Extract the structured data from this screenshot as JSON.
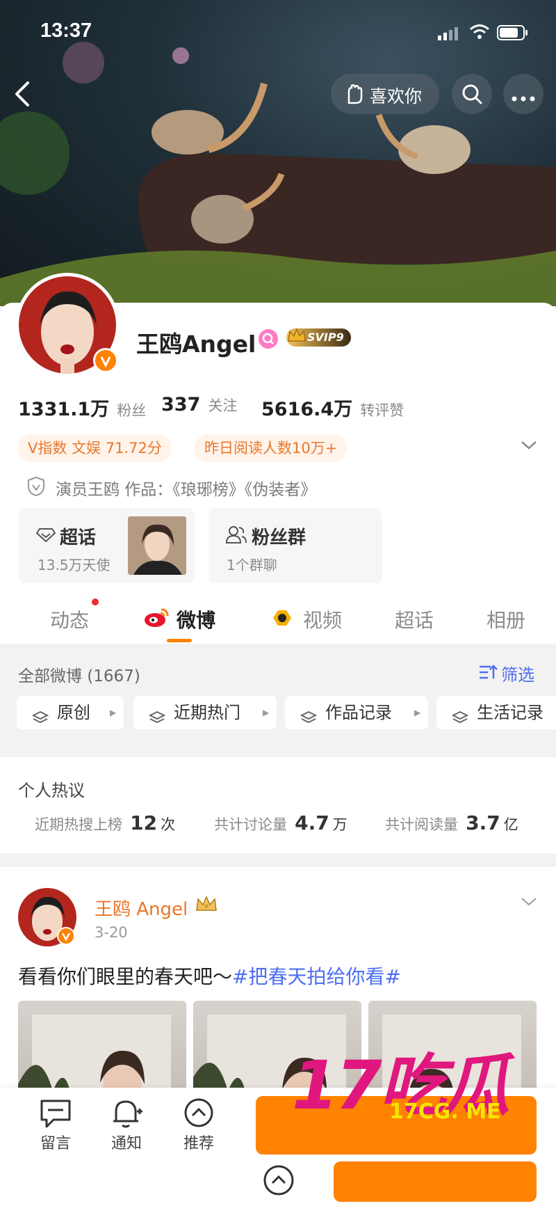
{
  "status": {
    "time": "13:37"
  },
  "header": {
    "like_label": "喜欢你"
  },
  "profile": {
    "name": "王鸥Angel",
    "svip": "SVIP9",
    "stats": [
      {
        "value": "1331.1万",
        "label": "粉丝"
      },
      {
        "value": "337",
        "label": "关注"
      },
      {
        "value": "5616.4万",
        "label": "转评赞"
      }
    ],
    "tags": [
      "V指数 文娱 71.72分",
      "昨日阅读人数10万+"
    ],
    "verify_text": "演员王鸥 作品：《琅琊榜》《伪装者》",
    "cards": [
      {
        "title": "超话",
        "sub": "13.5万天使"
      },
      {
        "title": "粉丝群",
        "sub": "1个群聊"
      }
    ],
    "tabs": [
      "动态",
      "微博",
      "视频",
      "超话",
      "相册"
    ]
  },
  "filter": {
    "all_label": "全部微博 (1667)",
    "filter_label": "筛选",
    "chips": [
      "原创",
      "近期热门",
      "作品记录",
      "生活记录"
    ]
  },
  "hot": {
    "title": "个人热议",
    "items": [
      {
        "label": "近期热搜上榜",
        "value": "12",
        "unit": "次"
      },
      {
        "label": "共计讨论量",
        "value": "4.7",
        "unit": "万"
      },
      {
        "label": "共计阅读量",
        "value": "3.7",
        "unit": "亿"
      }
    ]
  },
  "post": {
    "author": "王鸥 Angel",
    "date": "3-20",
    "text_plain": "看看你们眼里的春天吧～",
    "text_tag": "#把春天拍给你看#"
  },
  "bottom_bar": {
    "items": [
      "留言",
      "通知",
      "推荐"
    ]
  },
  "watermark": {
    "big": "17吃瓜",
    "small": "17CG. ME"
  },
  "colors": {
    "accent": "#ff8200",
    "link": "#4e6ef2",
    "tag_bg": "#fff3ea",
    "watermark": "#e0177e"
  }
}
